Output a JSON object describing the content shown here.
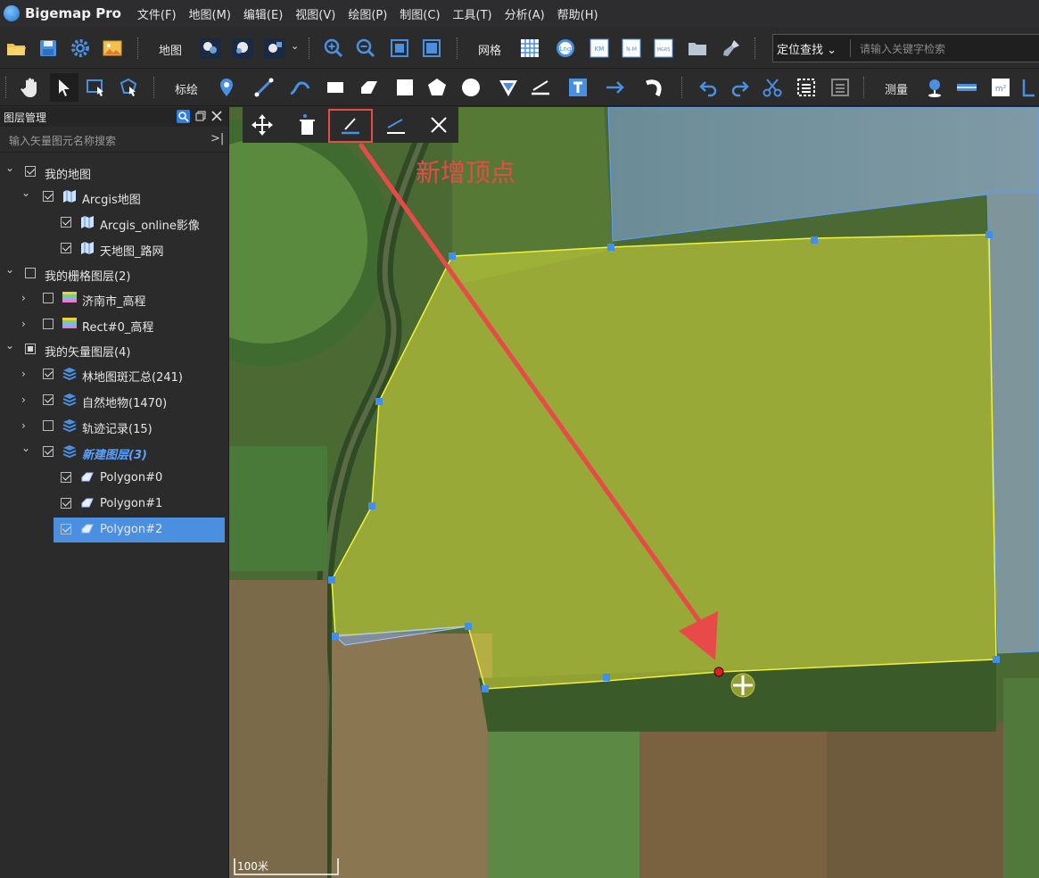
{
  "app": {
    "title": "Bigemap Pro"
  },
  "menu": [
    {
      "label": "文件(F)"
    },
    {
      "label": "地图(M)"
    },
    {
      "label": "编辑(E)"
    },
    {
      "label": "视图(V)"
    },
    {
      "label": "绘图(P)"
    },
    {
      "label": "制图(C)"
    },
    {
      "label": "工具(T)"
    },
    {
      "label": "分析(A)"
    },
    {
      "label": "帮助(H)"
    }
  ],
  "toolbar1": {
    "map_label": "地图",
    "grid_label": "网格",
    "grid_buttons": [
      "Lng",
      "KM",
      "N-M",
      "MGRS"
    ],
    "search_mode": "定位查找",
    "search_placeholder": "请输入关键字检索"
  },
  "toolbar2": {
    "annotate_label": "标绘",
    "measure_label": "测量"
  },
  "layer_panel": {
    "title": "图层管理",
    "search_placeholder": "输入矢量图元名称搜索",
    "tree": [
      {
        "label": "我的地图",
        "state": "checked",
        "expand": "v"
      },
      {
        "label": "Arcgis地图",
        "state": "checked",
        "expand": "v"
      },
      {
        "label": "Arcgis_online影像",
        "state": "checked",
        "expand": ""
      },
      {
        "label": "天地图_路网",
        "state": "checked",
        "expand": ""
      },
      {
        "label": "我的栅格图层(2)",
        "state": "unchecked",
        "expand": "v"
      },
      {
        "label": "济南市_高程",
        "state": "unchecked",
        "expand": ">"
      },
      {
        "label": "Rect#0_高程",
        "state": "unchecked",
        "expand": ">"
      },
      {
        "label": "我的矢量图层(4)",
        "state": "partial",
        "expand": "v"
      },
      {
        "label": "林地图斑汇总(241)",
        "state": "checked",
        "expand": ">"
      },
      {
        "label": "自然地物(1470)",
        "state": "checked",
        "expand": ">"
      },
      {
        "label": "轨迹记录(15)",
        "state": "unchecked",
        "expand": ">"
      },
      {
        "label": "新建图层(3)",
        "state": "checked",
        "expand": "v"
      },
      {
        "label": "Polygon#0",
        "state": "checked",
        "expand": ""
      },
      {
        "label": "Polygon#1",
        "state": "checked",
        "expand": ""
      },
      {
        "label": "Polygon#2",
        "state": "checked",
        "expand": "",
        "selected": true
      }
    ]
  },
  "map": {
    "annotation_text": "新增顶点",
    "annotation_color": "#e84a4a",
    "polygon_fill": "#d9dc3a",
    "vertex_color": "#3f8ef0",
    "new_vertex_color": "#e0201a",
    "scale_label": "100米"
  }
}
